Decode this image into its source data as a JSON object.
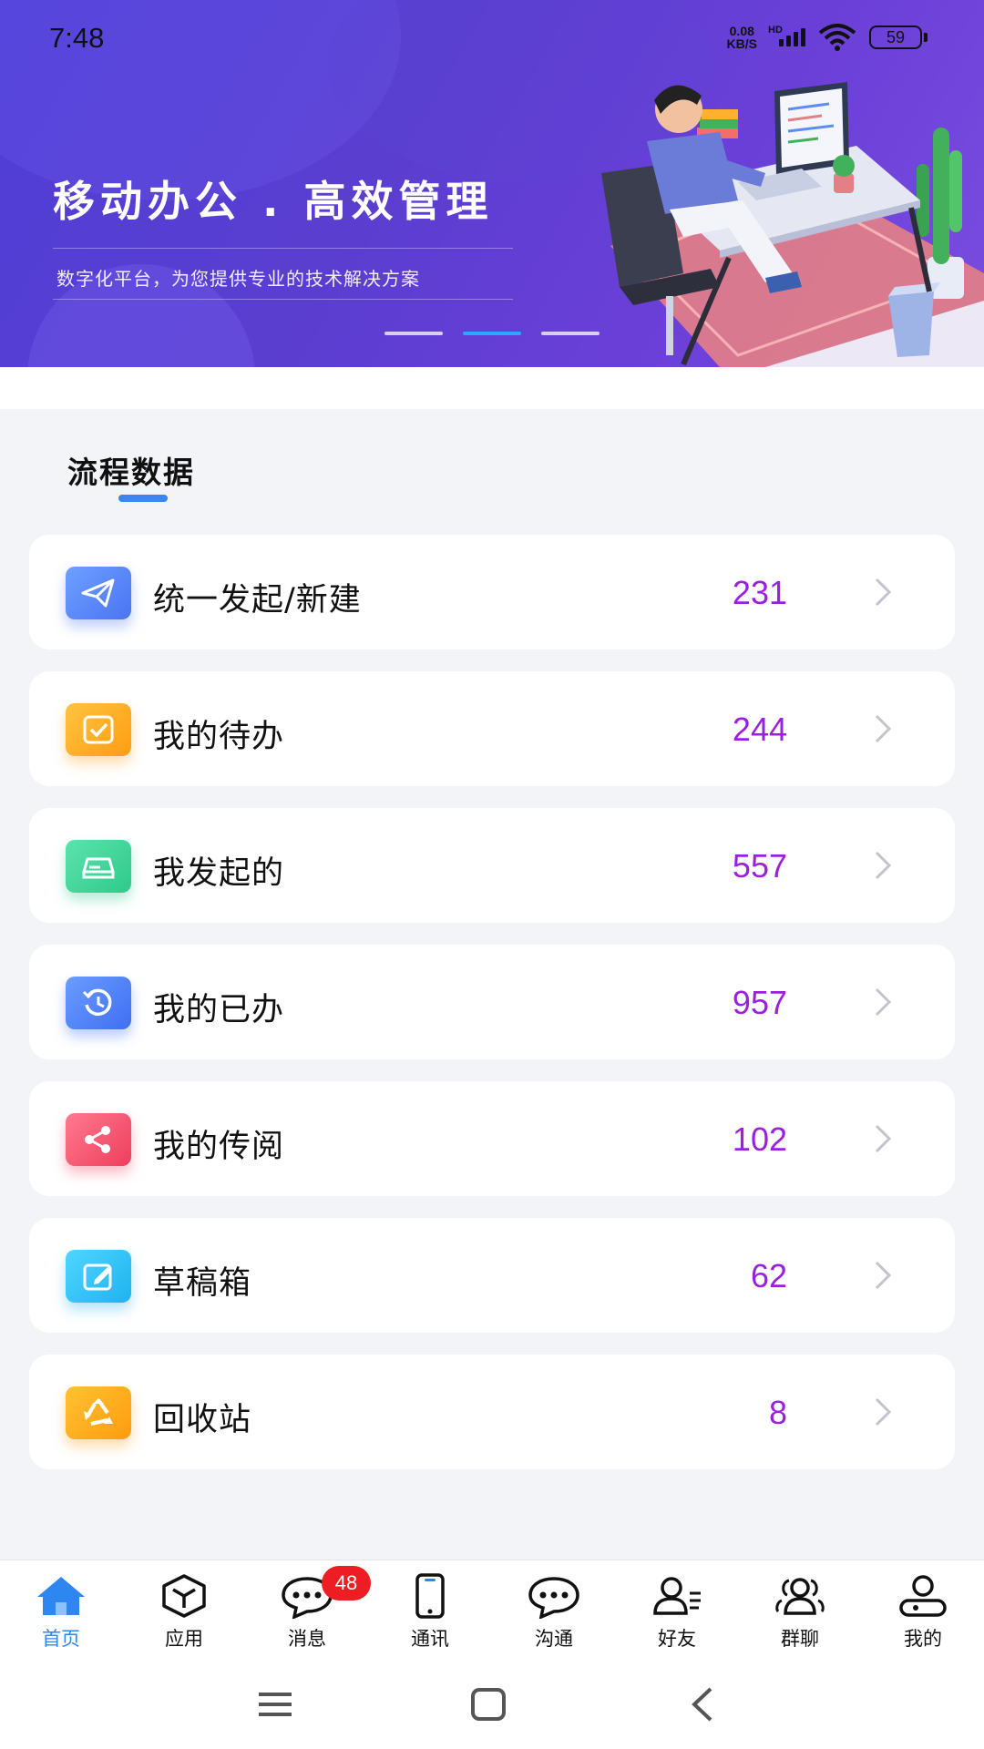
{
  "status_bar": {
    "time": "7:48",
    "net_speed_value": "0.08",
    "net_speed_unit": "KB/S",
    "network_badge": "HD",
    "battery": "59"
  },
  "banner": {
    "title": "移动办公 . 高效管理",
    "subtitle": "数字化平台，为您提供专业的技术解决方案",
    "slides": 3,
    "active_slide": 2
  },
  "section": {
    "title": "流程数据"
  },
  "items": [
    {
      "label": "统一发起/新建",
      "count": "231",
      "icon": "paper-plane-icon",
      "color": "#5b8cf7"
    },
    {
      "label": "我的待办",
      "count": "244",
      "icon": "check-box-icon",
      "color": "#ffad1f"
    },
    {
      "label": "我发起的",
      "count": "557",
      "icon": "drive-icon",
      "color": "#3dd39a"
    },
    {
      "label": "我的已办",
      "count": "957",
      "icon": "history-icon",
      "color": "#4d80f5"
    },
    {
      "label": "我的传阅",
      "count": "102",
      "icon": "share-icon",
      "color": "#f4546f"
    },
    {
      "label": "草稿箱",
      "count": "62",
      "icon": "edit-icon",
      "color": "#2ec4f2"
    },
    {
      "label": "回收站",
      "count": "8",
      "icon": "recycle-icon",
      "color": "#ffaa1a"
    }
  ],
  "tabs": [
    {
      "label": "首页",
      "icon": "home-icon",
      "active": true
    },
    {
      "label": "应用",
      "icon": "cube-icon",
      "active": false
    },
    {
      "label": "消息",
      "icon": "chat-icon",
      "active": false,
      "badge": "48"
    },
    {
      "label": "通讯",
      "icon": "phone-icon",
      "active": false
    },
    {
      "label": "沟通",
      "icon": "bubble-icon",
      "active": false
    },
    {
      "label": "好友",
      "icon": "friend-icon",
      "active": false
    },
    {
      "label": "群聊",
      "icon": "group-icon",
      "active": false
    },
    {
      "label": "我的",
      "icon": "profile-icon",
      "active": false
    }
  ],
  "colors": {
    "accent": "#2e86f0",
    "count_text": "#9b1fe0",
    "badge": "#ee1d23",
    "banner_start": "#4f3ed6",
    "banner_end": "#7a4de0"
  }
}
